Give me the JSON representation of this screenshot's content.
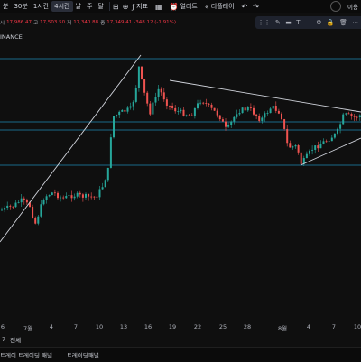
{
  "toolbar": {
    "timeframes": [
      "분",
      "30분",
      "1시간",
      "4시간",
      "날",
      "주",
      "달"
    ],
    "active_timeframe": "4시간",
    "indicators_label": "지표",
    "alert_label": "얼러트",
    "replay_label": "리플레이",
    "user_label": "이용",
    "icons": [
      "candles-icon",
      "plus-icon",
      "undo-icon",
      "redo-icon"
    ]
  },
  "info": {
    "open_label": "시",
    "open_value": "17,986.47",
    "high_label": "고",
    "high_value": "17,503.50",
    "low_label": "저",
    "low_value": "17,340.88",
    "close_label": "종",
    "close_value": "17,349.41",
    "change": "-348.12 (-1.91%)"
  },
  "symbol": "INANCE",
  "colors": {
    "up": "#26a69a",
    "down": "#ef5350",
    "hline": "#1e88b5",
    "trend": "#d1d4dc",
    "active": "#2a2e39"
  },
  "date_axis": [
    "6",
    "7월",
    "4",
    "7",
    "10",
    "13",
    "16",
    "19",
    "22",
    "25",
    "28",
    "8월",
    "4",
    "7",
    "10"
  ],
  "range": {
    "items": [
      "7",
      "전체"
    ]
  },
  "bottom": {
    "tabs": [
      "트레이 트레이딩 패널",
      "트레이딩패널"
    ]
  }
}
